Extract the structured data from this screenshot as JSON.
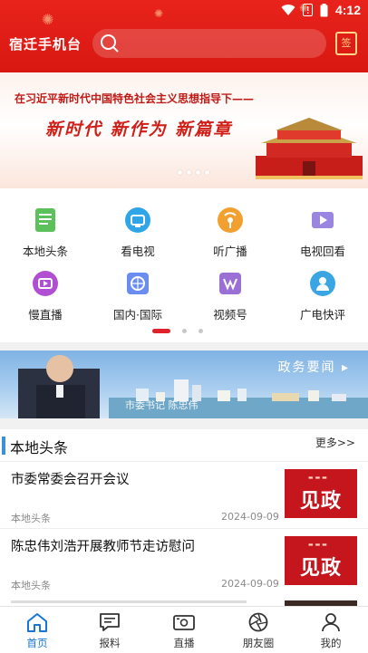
{
  "status": {
    "time": "4:12"
  },
  "header": {
    "app_name": "宿迁手机台",
    "sign_label": "签"
  },
  "banner": {
    "line": "在习近平新时代中国特色社会主义思想指导下——",
    "slogan": "新时代  新作为  新篇章"
  },
  "grid": [
    {
      "label": "本地头条",
      "icon": "headline-icon",
      "color": "#5cc15a"
    },
    {
      "label": "看电视",
      "icon": "tv-icon",
      "color": "#2fa5e8"
    },
    {
      "label": "听广播",
      "icon": "radio-icon",
      "color": "#f2a030"
    },
    {
      "label": "电视回看",
      "icon": "replay-icon",
      "color": "#9a86e0"
    },
    {
      "label": "慢直播",
      "icon": "slow-live-icon",
      "color": "#b04fd1"
    },
    {
      "label": "国内·国际",
      "icon": "globe-icon",
      "color": "#6b8df0"
    },
    {
      "label": "视频号",
      "icon": "video-channel-icon",
      "color": "#9a70d6"
    },
    {
      "label": "广电快评",
      "icon": "commentary-icon",
      "color": "#3aa5e3"
    }
  ],
  "promo": {
    "title": "政务要闻 ▸",
    "caption": "市委书记  陈忠伟"
  },
  "section": {
    "title": "本地头条",
    "more": "更多>>"
  },
  "news": [
    {
      "title": "市委常委会召开会议",
      "source": "本地头条",
      "date": "2024-09-09",
      "thumb": "见政"
    },
    {
      "title": "陈忠伟刘浩开展教师节走访慰问",
      "source": "本地头条",
      "date": "2024-09-09",
      "thumb": "见政"
    }
  ],
  "tabs": [
    {
      "label": "首页",
      "icon": "home-icon",
      "active": true
    },
    {
      "label": "报料",
      "icon": "report-icon",
      "active": false
    },
    {
      "label": "直播",
      "icon": "live-camera-icon",
      "active": false
    },
    {
      "label": "朋友圈",
      "icon": "aperture-icon",
      "active": false
    },
    {
      "label": "我的",
      "icon": "profile-icon",
      "active": false
    }
  ],
  "colors": {
    "brand_red": "#d81811",
    "accent_blue": "#1776d8"
  }
}
